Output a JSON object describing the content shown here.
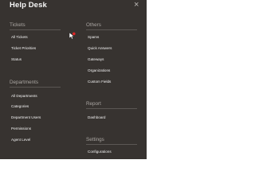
{
  "title": "Help Desk",
  "close_icon": "close-icon",
  "colors": {
    "panel_bg": "#373330",
    "header_text": "#aaa6a2",
    "item_text": "#f2f2f2",
    "divider": "#5b5754",
    "badge": "#e22626"
  },
  "sections": {
    "tickets": {
      "header": "Tickets",
      "items": [
        "All Tickets",
        "Ticket Priorities",
        "Status"
      ]
    },
    "others": {
      "header": "Others",
      "items": [
        "Spams",
        "Quick Answers",
        "Gateways",
        "Organizations",
        "Custom Fields"
      ]
    },
    "departments": {
      "header": "Departments",
      "items": [
        "All Departments",
        "Categories",
        "Department Users",
        "Permissions",
        "Agent Level"
      ]
    },
    "report": {
      "header": "Report",
      "items": [
        "Dashboard"
      ]
    },
    "settings": {
      "header": "Settings",
      "items": [
        "Configurations"
      ]
    }
  }
}
